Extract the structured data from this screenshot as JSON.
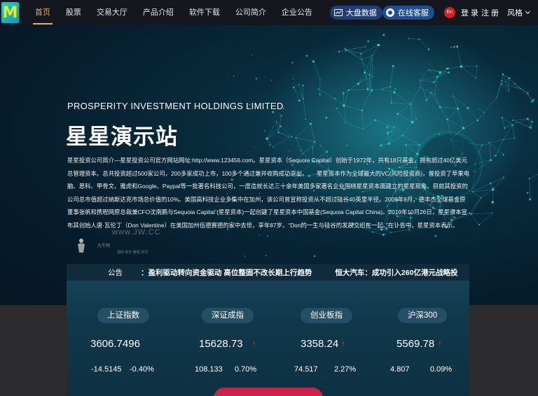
{
  "nav": {
    "logo_text": "M",
    "items": [
      {
        "label": "首页",
        "active": true
      },
      {
        "label": "股票"
      },
      {
        "label": "交易大厅"
      },
      {
        "label": "产品介绍"
      },
      {
        "label": "软件下载"
      },
      {
        "label": "公司简介"
      },
      {
        "label": "企业公告"
      }
    ],
    "big_data_label": "大盘数据",
    "service_label": "在线客服",
    "lang_label": "En",
    "login_label": "登 录",
    "register_label": "注 册",
    "style_label": "风格"
  },
  "hero": {
    "company_en": "PROSPERITY INVESTMENT HOLDINGS LIMITED",
    "site_title": "星星演示站",
    "description": "星星投资公司简介—星星投资公司官方网站网址:http://www.123456.com。星星资本（Sequoia Capital）创始于1972年，共有18只基金，拥有超过40亿美元总管理资本。总共投资超过500家公司，200多家成功上市，100多个通过兼并收购成功退出。　　星星资本作为全球最大的VC(风险投资商)，曾投资了苹果电脑、思科、甲骨文、雅虎和Google、Paypal等一批著名科技公司，一度造就长达三十余年美国多家著名企业围绕星星资本而建立的星星现象。目前其投资的公司总市值超过纳斯达克市场总价值的10%。美国高科技企业多集中在加州，该公司曾宣称投资从不超过硅谷40英里半径。2005年9月，德丰杰全球基金原董事张帆和携程网原总裁兼CFO沈南鹏与Sequoia Capital (星星资本)一起创建了星星资本中国基金(Sequoia Capital China)。2019年10月26日，星星资本宣布其创始人唐·瓦伦丁（Don Valentine）在美国加州伍德赛德的家中去世，享年87岁。“Don的一生与硅谷的发展交织在一起。”在讣告中，星星资本表示。",
    "watermark": "www.JW.CC",
    "wm_name": "九牛网",
    "wm_sub": "源码 软件 教程 资讯"
  },
  "ticker": {
    "label": "公告",
    "items": [
      "：盈利驱动转向资金驱动 高位整固不改长期上行趋势",
      "恒大汽车：成功引入260亿港元战略投"
    ]
  },
  "stocks": [
    {
      "name": "上证指数",
      "price": "3606.7496",
      "up": false,
      "change": "-14.5145",
      "pct": "-0.40%"
    },
    {
      "name": "深证成指",
      "price": "15628.73",
      "up": true,
      "change": "108.133",
      "pct": "0.70%"
    },
    {
      "name": "创业板指",
      "price": "3358.24",
      "up": true,
      "change": "74.517",
      "pct": "2.27%"
    },
    {
      "name": "沪深300",
      "price": "5569.78",
      "up": true,
      "change": "4.807",
      "pct": "0.09%"
    }
  ],
  "colors": {
    "nav_bg": "#14171d",
    "active": "#e9b54d",
    "up": "#e23a3a",
    "panel": "#10384b",
    "cta": "#d21f4a"
  }
}
